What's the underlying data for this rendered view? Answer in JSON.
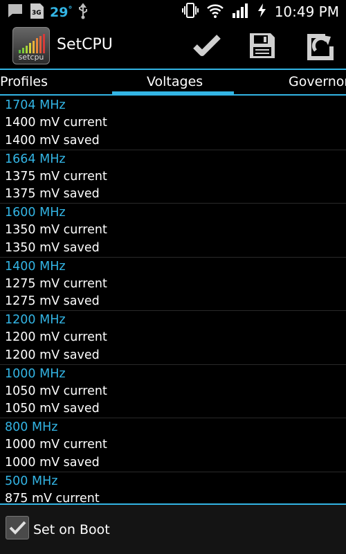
{
  "status_bar": {
    "temperature": "29",
    "temperature_unit": "°",
    "network_type": "3G",
    "time": "10:49 PM",
    "icons": [
      "chat-notification-icon",
      "sim-3g-icon",
      "usb-icon",
      "vibrate-icon",
      "wifi-icon",
      "signal-icon",
      "charging-icon"
    ]
  },
  "action_bar": {
    "app_title": "SetCPU",
    "app_icon_label": "setcpu",
    "actions": [
      "check-icon",
      "save-icon",
      "reload-icon"
    ]
  },
  "tabs": [
    {
      "label": "Profiles",
      "selected": false
    },
    {
      "label": "Voltages",
      "selected": true
    },
    {
      "label": "Governor",
      "selected": false
    }
  ],
  "voltages": [
    {
      "frequency": "1704 MHz",
      "current": "1400 mV current",
      "saved": "1400 mV saved"
    },
    {
      "frequency": "1664 MHz",
      "current": "1375 mV current",
      "saved": "1375 mV saved"
    },
    {
      "frequency": "1600 MHz",
      "current": "1350 mV current",
      "saved": "1350 mV saved"
    },
    {
      "frequency": "1400 MHz",
      "current": "1275 mV current",
      "saved": "1275 mV saved"
    },
    {
      "frequency": "1200 MHz",
      "current": "1200 mV current",
      "saved": "1200 mV saved"
    },
    {
      "frequency": "1000 MHz",
      "current": "1050 mV current",
      "saved": "1050 mV saved"
    },
    {
      "frequency": "800 MHz",
      "current": "1000 mV current",
      "saved": "1000 mV saved"
    },
    {
      "frequency": "500 MHz",
      "current": "875 mV current",
      "saved": ""
    }
  ],
  "footer": {
    "set_on_boot_label": "Set on Boot",
    "set_on_boot_checked": true
  },
  "colors": {
    "accent": "#33b5e5",
    "background": "#000000"
  }
}
